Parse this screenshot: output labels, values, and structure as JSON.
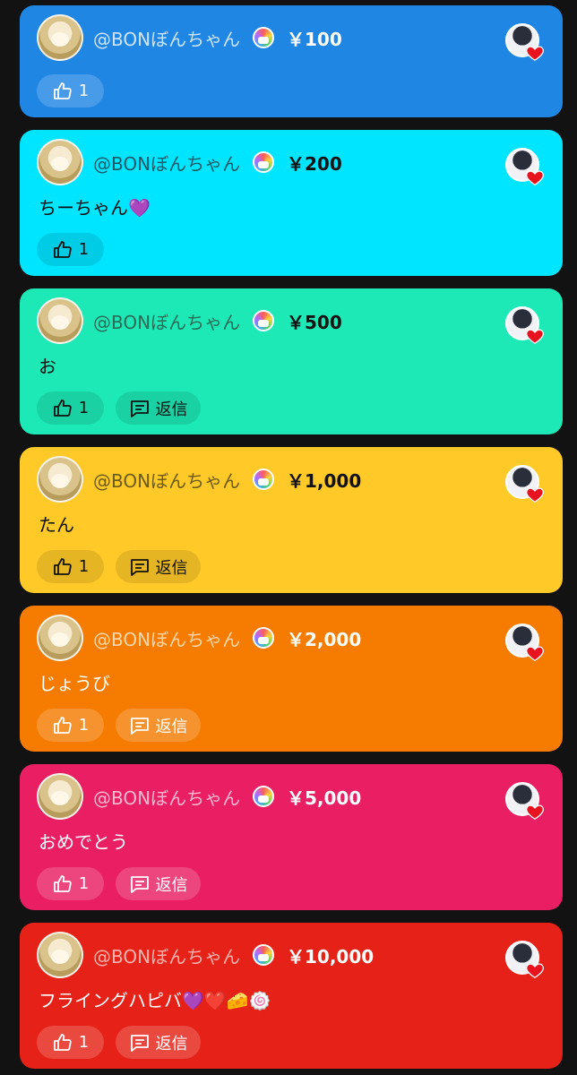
{
  "cards": [
    {
      "username": "@BONぼんちゃん",
      "amount": "￥100",
      "message": "",
      "likes": "1",
      "reply_label": "",
      "bg": "#1f86e3",
      "name_color": "#cfe3f7",
      "text_color": "#ffffff",
      "btn_bg": "rgba(255,255,255,0.18)"
    },
    {
      "username": "@BONぼんちゃん",
      "amount": "￥200",
      "message": "ちーちゃん💜",
      "likes": "1",
      "reply_label": "",
      "bg": "#00e5ff",
      "name_color": "#1f5a66",
      "text_color": "#111111",
      "btn_bg": "rgba(0,0,0,0.10)"
    },
    {
      "username": "@BONぼんちゃん",
      "amount": "￥500",
      "message": "お",
      "likes": "1",
      "reply_label": "返信",
      "bg": "#1de9b6",
      "name_color": "#2b6b58",
      "text_color": "#111111",
      "btn_bg": "rgba(0,0,0,0.10)"
    },
    {
      "username": "@BONぼんちゃん",
      "amount": "￥1,000",
      "message": "たん",
      "likes": "1",
      "reply_label": "返信",
      "bg": "#ffca28",
      "name_color": "#6e5a1a",
      "text_color": "#111111",
      "btn_bg": "rgba(0,0,0,0.10)"
    },
    {
      "username": "@BONぼんちゃん",
      "amount": "￥2,000",
      "message": "じょうび",
      "likes": "1",
      "reply_label": "返信",
      "bg": "#f57c00",
      "name_color": "#fbd6ad",
      "text_color": "#ffffff",
      "btn_bg": "rgba(255,255,255,0.18)"
    },
    {
      "username": "@BONぼんちゃん",
      "amount": "￥5,000",
      "message": "おめでとう",
      "likes": "1",
      "reply_label": "返信",
      "bg": "#e91e63",
      "name_color": "#f8b8cd",
      "text_color": "#ffffff",
      "btn_bg": "rgba(255,255,255,0.18)"
    },
    {
      "username": "@BONぼんちゃん",
      "amount": "￥10,000",
      "message": "フライングハピバ💜❤️🧀🍥",
      "likes": "1",
      "reply_label": "返信",
      "bg": "#e62117",
      "name_color": "#f7b3ae",
      "text_color": "#ffffff",
      "btn_bg": "rgba(255,255,255,0.18)"
    }
  ],
  "icons": {
    "like": "thumbs-up-icon",
    "reply": "comment-icon",
    "heart": "heart-icon",
    "badge": "member-badge-icon"
  },
  "colors": {
    "background": "#121212",
    "heart": "#e8131f"
  }
}
